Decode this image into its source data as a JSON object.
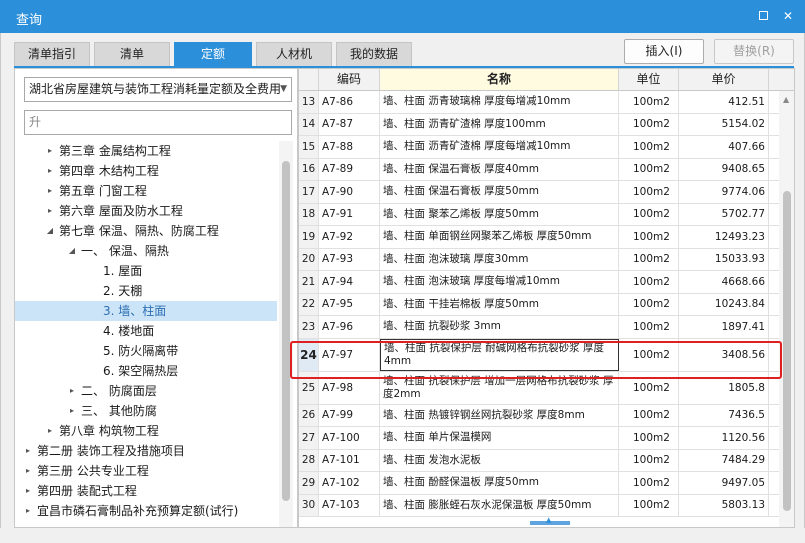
{
  "window": {
    "title": "查询",
    "maximize_label": "maximize",
    "close_glyph": "✕"
  },
  "tabs": [
    {
      "label": "清单指引",
      "active": false
    },
    {
      "label": "清单",
      "active": false
    },
    {
      "label": "定额",
      "active": true
    },
    {
      "label": "人材机",
      "active": false
    },
    {
      "label": "我的数据",
      "active": false
    }
  ],
  "buttons": {
    "insert": "插入(I)",
    "replace": "替换(R)"
  },
  "left": {
    "library_combo": "湖北省房屋建筑与装饰工程消耗量定额及全费用",
    "search_value": "升",
    "tree": [
      {
        "label": "第三章 金属结构工程",
        "level": 1,
        "expander": "▸"
      },
      {
        "label": "第四章 木结构工程",
        "level": 1,
        "expander": "▸"
      },
      {
        "label": "第五章 门窗工程",
        "level": 1,
        "expander": "▸"
      },
      {
        "label": "第六章 屋面及防水工程",
        "level": 1,
        "expander": "▸"
      },
      {
        "label": "第七章 保温、隔热、防腐工程",
        "level": 1,
        "expander": "◢"
      },
      {
        "label": "一、 保温、隔热",
        "level": 2,
        "expander": "◢"
      },
      {
        "label": "1. 屋面",
        "level": 3,
        "expander": ""
      },
      {
        "label": "2. 天棚",
        "level": 3,
        "expander": ""
      },
      {
        "label": "3. 墙、柱面",
        "level": 3,
        "expander": "",
        "selected": true
      },
      {
        "label": "4. 楼地面",
        "level": 3,
        "expander": ""
      },
      {
        "label": "5. 防火隔离带",
        "level": 3,
        "expander": ""
      },
      {
        "label": "6. 架空隔热层",
        "level": 3,
        "expander": ""
      },
      {
        "label": "二、 防腐面层",
        "level": 2,
        "expander": "▸"
      },
      {
        "label": "三、 其他防腐",
        "level": 2,
        "expander": "▸"
      },
      {
        "label": "第八章 构筑物工程",
        "level": 1,
        "expander": "▸"
      },
      {
        "label": "第二册 装饰工程及措施项目",
        "level": 0,
        "expander": "▸"
      },
      {
        "label": "第三册 公共专业工程",
        "level": 0,
        "expander": "▸"
      },
      {
        "label": "第四册 装配式工程",
        "level": 0,
        "expander": "▸"
      },
      {
        "label": "宜昌市磷石膏制品补充预算定额(试行)",
        "level": 0,
        "expander": "▸"
      }
    ]
  },
  "grid": {
    "headers": {
      "num": "",
      "code": "编码",
      "name": "名称",
      "unit": "单位",
      "price": "单价"
    },
    "rows": [
      {
        "num": "13",
        "code": "A7-86",
        "name": "墙、柱面 沥青玻璃棉 厚度每增减10mm",
        "unit": "100m2",
        "price": "412.51"
      },
      {
        "num": "14",
        "code": "A7-87",
        "name": "墙、柱面 沥青矿渣棉 厚度100mm",
        "unit": "100m2",
        "price": "5154.02"
      },
      {
        "num": "15",
        "code": "A7-88",
        "name": "墙、柱面 沥青矿渣棉 厚度每增减10mm",
        "unit": "100m2",
        "price": "407.66"
      },
      {
        "num": "16",
        "code": "A7-89",
        "name": "墙、柱面 保温石膏板 厚度40mm",
        "unit": "100m2",
        "price": "9408.65"
      },
      {
        "num": "17",
        "code": "A7-90",
        "name": "墙、柱面 保温石膏板 厚度50mm",
        "unit": "100m2",
        "price": "9774.06"
      },
      {
        "num": "18",
        "code": "A7-91",
        "name": "墙、柱面 聚苯乙烯板 厚度50mm",
        "unit": "100m2",
        "price": "5702.77"
      },
      {
        "num": "19",
        "code": "A7-92",
        "name": "墙、柱面 单面钢丝网聚苯乙烯板 厚度50mm",
        "unit": "100m2",
        "price": "12493.23"
      },
      {
        "num": "20",
        "code": "A7-93",
        "name": "墙、柱面 泡沫玻璃 厚度30mm",
        "unit": "100m2",
        "price": "15033.93"
      },
      {
        "num": "21",
        "code": "A7-94",
        "name": "墙、柱面 泡沫玻璃 厚度每增减10mm",
        "unit": "100m2",
        "price": "4668.66"
      },
      {
        "num": "22",
        "code": "A7-95",
        "name": "墙、柱面 干挂岩棉板 厚度50mm",
        "unit": "100m2",
        "price": "10243.84"
      },
      {
        "num": "23",
        "code": "A7-96",
        "name": "墙、柱面 抗裂砂浆 3mm",
        "unit": "100m2",
        "price": "1897.41"
      },
      {
        "num": "24",
        "code": "A7-97",
        "name": "墙、柱面 抗裂保护层 耐碱网格布抗裂砂浆 厚度4mm",
        "unit": "100m2",
        "price": "3408.56",
        "tall": true,
        "highlight": true
      },
      {
        "num": "25",
        "code": "A7-98",
        "name": "墙、柱面 抗裂保护层 增加一层网格布抗裂砂浆 厚度2mm",
        "unit": "100m2",
        "price": "1805.8",
        "tall": true
      },
      {
        "num": "26",
        "code": "A7-99",
        "name": "墙、柱面 热镀锌钢丝网抗裂砂浆 厚度8mm",
        "unit": "100m2",
        "price": "7436.5"
      },
      {
        "num": "27",
        "code": "A7-100",
        "name": "墙、柱面 单片保温模网",
        "unit": "100m2",
        "price": "1120.56"
      },
      {
        "num": "28",
        "code": "A7-101",
        "name": "墙、柱面 发泡水泥板",
        "unit": "100m2",
        "price": "7484.29"
      },
      {
        "num": "29",
        "code": "A7-102",
        "name": "墙、柱面 酚醛保温板 厚度50mm",
        "unit": "100m2",
        "price": "9497.05"
      },
      {
        "num": "30",
        "code": "A7-103",
        "name": "墙、柱面 膨胀蛭石灰水泥保温板 厚度50mm",
        "unit": "100m2",
        "price": "5803.13"
      }
    ]
  }
}
